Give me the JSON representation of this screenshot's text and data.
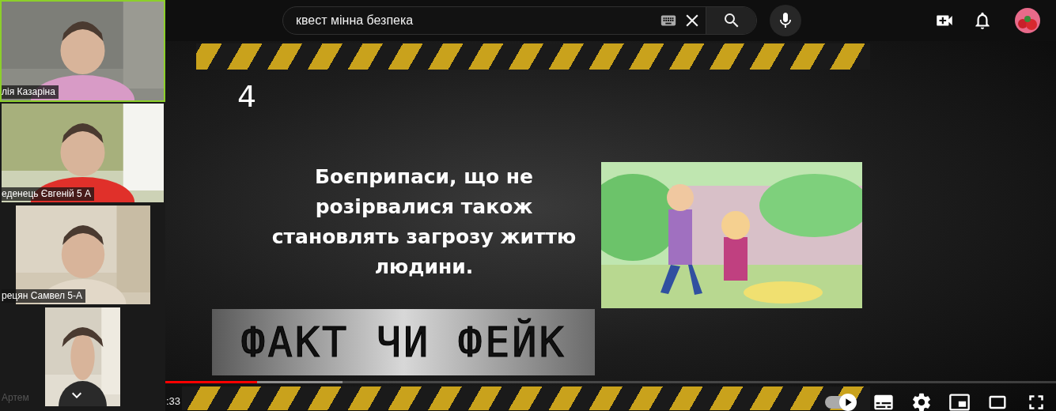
{
  "participants": [
    {
      "name": "лія Казаріна",
      "active": true,
      "kind": "wide"
    },
    {
      "name": "еденець Євгеній 5 А",
      "active": false,
      "kind": "wide"
    },
    {
      "name": "рецян Самвел 5-А",
      "active": false,
      "kind": "medium"
    },
    {
      "name": "Артем",
      "active": false,
      "kind": "narrow"
    }
  ],
  "search": {
    "value": "квест мінна безпека"
  },
  "slide": {
    "number": "4",
    "statement": "Боєприпаси, що не розірвалися також становлять загрозу життю людини.",
    "banner": "ФАКТ ЧИ ФЕЙК"
  },
  "player": {
    "time": ":33",
    "progress": {
      "level": 0.104
    },
    "buffer": {
      "level": 0.2
    },
    "autoplay": {
      "on": true
    }
  }
}
